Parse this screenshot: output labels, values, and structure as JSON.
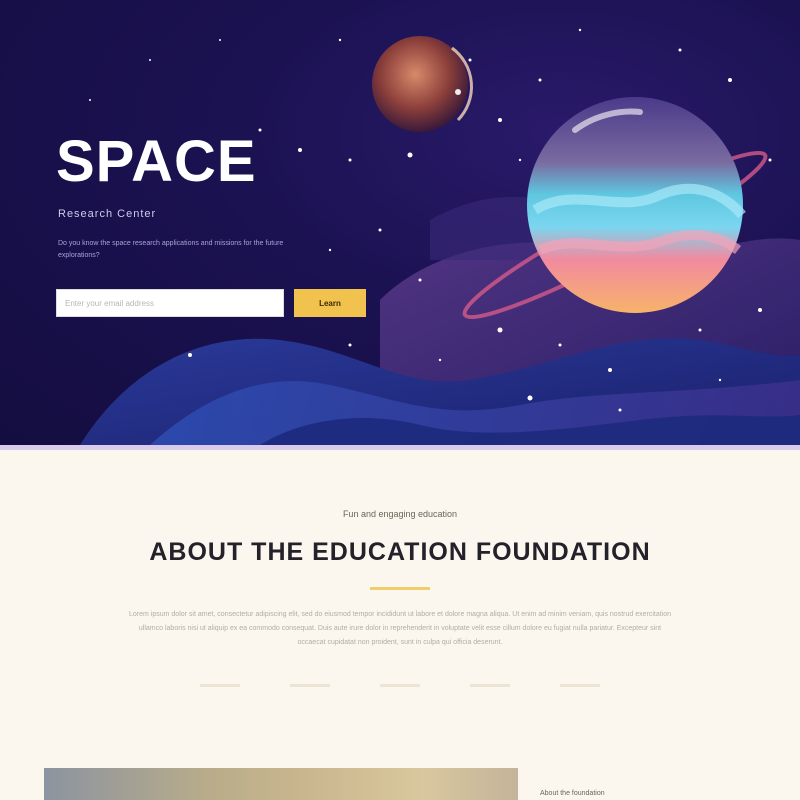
{
  "hero": {
    "title": "SPACE",
    "subtitle": "Research Center",
    "description": "Do you know the space research applications and missions for the future explorations?",
    "search_placeholder": "Enter your email address",
    "button_label": "Learn"
  },
  "about": {
    "kicker": "Fun and engaging education",
    "title": "ABOUT THE EDUCATION FOUNDATION",
    "body": "Lorem ipsum dolor sit amet, consectetur adipiscing elit, sed do eiusmod tempor incididunt ut labore et dolore magna aliqua. Ut enim ad minim veniam, quis nostrud exercitation ullamco laboris nisi ut aliquip ex ea commodo consequat. Duis aute irure dolor in reprehenderit in voluptate velit esse cillum dolore eu fugiat nulla pariatur. Excepteur sint occaecat cupidatat non proident, sunt in culpa qui officia deserunt."
  },
  "preview": {
    "caption": "About the foundation"
  },
  "colors": {
    "hero_bg": "#1b1252",
    "accent": "#f2c24e",
    "page_bg": "#fbf7ef"
  }
}
